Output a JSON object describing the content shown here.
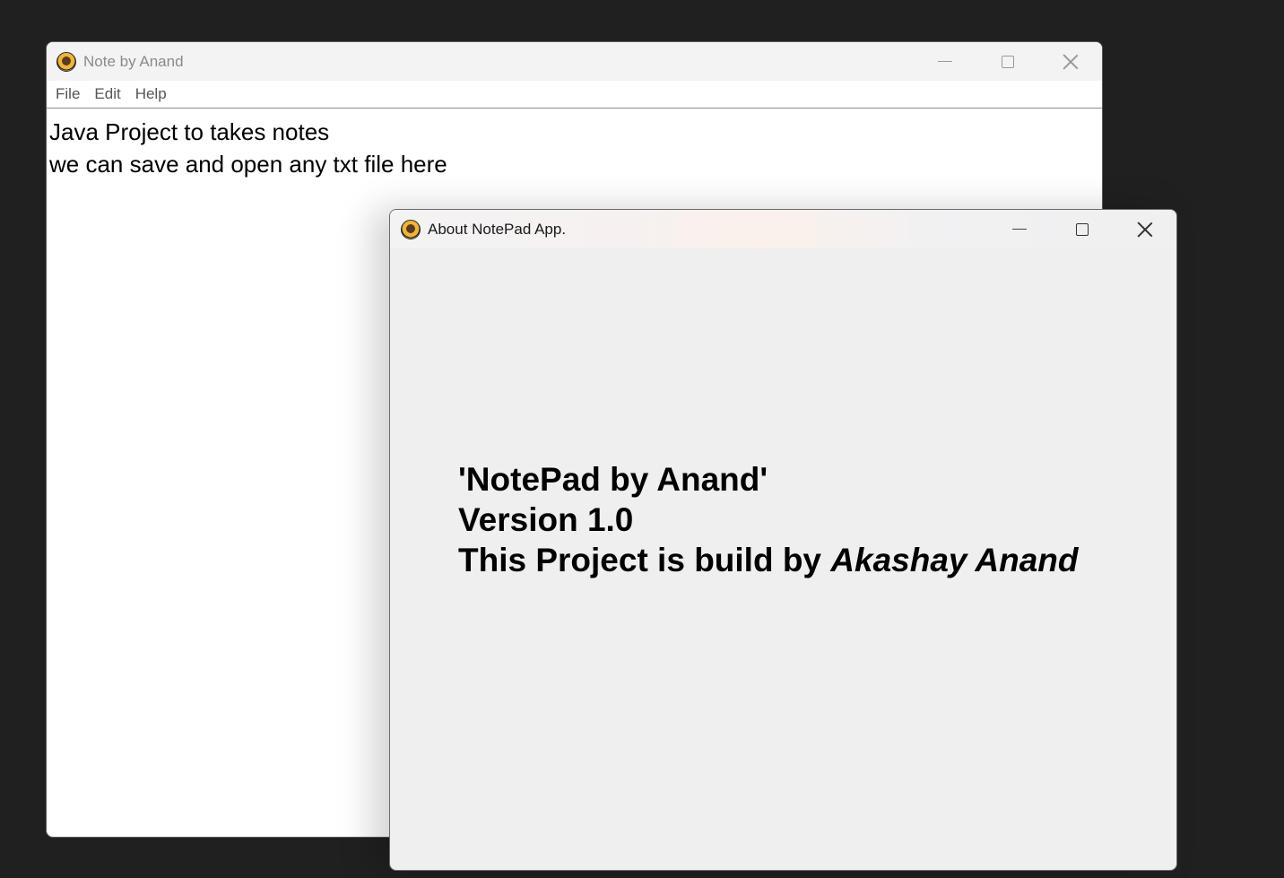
{
  "main_window": {
    "title": "Note by Anand",
    "menu": [
      "File",
      "Edit",
      "Help"
    ],
    "text_lines": [
      "Java Project to takes notes",
      "we can save and open any txt file here"
    ]
  },
  "about_window": {
    "title": "About NotePad App.",
    "line1": "'NotePad by Anand'",
    "line2": "Version 1.0",
    "line3_prefix": "This Project is build by ",
    "line3_author": "Akashay Anand"
  },
  "icons": {
    "app": "app-logo-icon",
    "minimize": "minimize-icon",
    "maximize": "maximize-icon",
    "close": "close-icon"
  }
}
